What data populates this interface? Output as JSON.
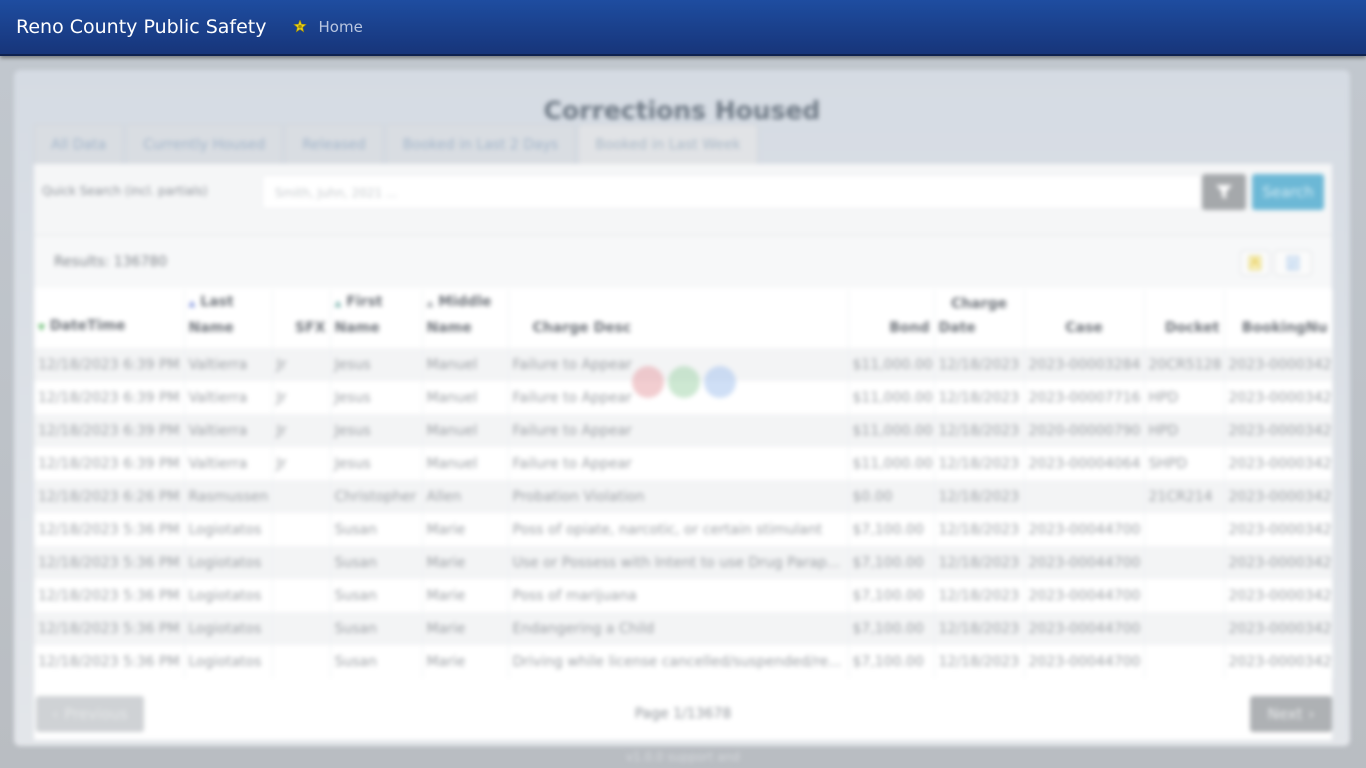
{
  "app": {
    "brand": "Reno County Public Safety",
    "home_label": "Home"
  },
  "page": {
    "title": "Corrections Housed",
    "tabs": [
      "All Data",
      "Currently Housed",
      "Released",
      "Booked in Last 2 Days",
      "Booked in Last Week"
    ]
  },
  "search": {
    "label": "Quick Search (incl. partials)",
    "placeholder": "Smith, Juhn, 2021 ...",
    "button_label": "Search"
  },
  "results": {
    "text": "Results: 136780"
  },
  "table": {
    "columns": [
      {
        "line1": "",
        "line2": "DateTime"
      },
      {
        "line1": "Last",
        "line2": "Name"
      },
      {
        "line1": "",
        "line2": "SFX"
      },
      {
        "line1": "First",
        "line2": "Name"
      },
      {
        "line1": "Middle",
        "line2": "Name"
      },
      {
        "line1": "",
        "line2": "Charge Desc"
      },
      {
        "line1": "",
        "line2": "Bond"
      },
      {
        "line1": "Charge",
        "line2": "Date"
      },
      {
        "line1": "",
        "line2": "Case"
      },
      {
        "line1": "",
        "line2": "Docket"
      },
      {
        "line1": "",
        "line2": "BookingNu"
      }
    ],
    "rows": [
      [
        "12/18/2023 6:39 PM",
        "Valtierra",
        "Jr",
        "Jesus",
        "Manuel",
        "Failure to Appear",
        "$11,000.00",
        "12/18/2023",
        "2023-00003284",
        "20CR5128",
        "2023-0000342"
      ],
      [
        "12/18/2023 6:39 PM",
        "Valtierra",
        "Jr",
        "Jesus",
        "Manuel",
        "Failure to Appear",
        "$11,000.00",
        "12/18/2023",
        "2023-00007716",
        "HPD",
        "2023-0000342"
      ],
      [
        "12/18/2023 6:39 PM",
        "Valtierra",
        "Jr",
        "Jesus",
        "Manuel",
        "Failure to Appear",
        "$11,000.00",
        "12/18/2023",
        "2020-00000790",
        "HPD",
        "2023-0000342"
      ],
      [
        "12/18/2023 6:39 PM",
        "Valtierra",
        "Jr",
        "Jesus",
        "Manuel",
        "Failure to Appear",
        "$11,000.00",
        "12/18/2023",
        "2023-00004064",
        "SHPD",
        "2023-0000342"
      ],
      [
        "12/18/2023 6:26 PM",
        "Rasmussen",
        "",
        "Christopher",
        "Allen",
        "Probation Violation",
        "$0.00",
        "12/18/2023",
        "",
        "21CR214",
        "2023-0000342"
      ],
      [
        "12/18/2023 5:36 PM",
        "Logiotatos",
        "",
        "Susan",
        "Marie",
        "Poss of opiate, narcotic, or certain stimulant",
        "$7,100.00",
        "12/18/2023",
        "2023-00044700",
        "",
        "2023-0000342"
      ],
      [
        "12/18/2023 5:36 PM",
        "Logiotatos",
        "",
        "Susan",
        "Marie",
        "Use or Possess with Intent to use Drug Parap...",
        "$7,100.00",
        "12/18/2023",
        "2023-00044700",
        "",
        "2023-0000342"
      ],
      [
        "12/18/2023 5:36 PM",
        "Logiotatos",
        "",
        "Susan",
        "Marie",
        "Poss of marijuana",
        "$7,100.00",
        "12/18/2023",
        "2023-00044700",
        "",
        "2023-0000342"
      ],
      [
        "12/18/2023 5:36 PM",
        "Logiotatos",
        "",
        "Susan",
        "Marie",
        "Endangering a Child",
        "$7,100.00",
        "12/18/2023",
        "2023-00044700",
        "",
        "2023-0000342"
      ],
      [
        "12/18/2023 5:36 PM",
        "Logiotatos",
        "",
        "Susan",
        "Marie",
        "Driving while license cancelled/suspended/re...",
        "$7,100.00",
        "12/18/2023",
        "2023-00044700",
        "",
        "2023-0000342"
      ]
    ]
  },
  "pager": {
    "prev_label": "Previous",
    "next_label": "Next",
    "page_text": "Page 1/13678"
  },
  "footer": {
    "text": "v1.0.0 support and"
  },
  "colors": {
    "navbar": "#1e4da0",
    "search_button": "#6cb8d6",
    "loader_dots": [
      "#e8a4aa",
      "#a4d6ad",
      "#a8c4ee"
    ]
  }
}
